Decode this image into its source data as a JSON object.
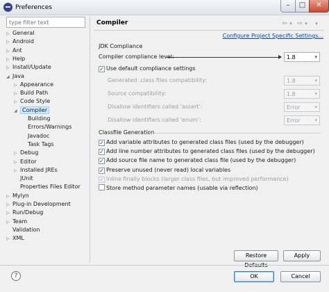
{
  "window": {
    "title": "Preferences",
    "minimize": "–",
    "maximize": "□",
    "close": "✕"
  },
  "filter": {
    "placeholder": "type filter text"
  },
  "tree": [
    {
      "label": "General",
      "expander": "▷",
      "depth": 0
    },
    {
      "label": "Android",
      "expander": "▷",
      "depth": 0
    },
    {
      "label": "Ant",
      "expander": "▷",
      "depth": 0
    },
    {
      "label": "Help",
      "expander": "▷",
      "depth": 0
    },
    {
      "label": "Install/Update",
      "expander": "▷",
      "depth": 0
    },
    {
      "label": "Java",
      "expander": "◢",
      "depth": 0
    },
    {
      "label": "Appearance",
      "expander": "▷",
      "depth": 1
    },
    {
      "label": "Build Path",
      "expander": "▷",
      "depth": 1
    },
    {
      "label": "Code Style",
      "expander": "▷",
      "depth": 1
    },
    {
      "label": "Compiler",
      "expander": "◢",
      "depth": 1,
      "selected": true
    },
    {
      "label": "Building",
      "expander": "",
      "depth": 2
    },
    {
      "label": "Errors/Warnings",
      "expander": "",
      "depth": 2
    },
    {
      "label": "Javadoc",
      "expander": "",
      "depth": 2
    },
    {
      "label": "Task Tags",
      "expander": "",
      "depth": 2
    },
    {
      "label": "Debug",
      "expander": "▷",
      "depth": 1
    },
    {
      "label": "Editor",
      "expander": "▷",
      "depth": 1
    },
    {
      "label": "Installed JREs",
      "expander": "▷",
      "depth": 1
    },
    {
      "label": "JUnit",
      "expander": "",
      "depth": 1
    },
    {
      "label": "Properties Files Editor",
      "expander": "",
      "depth": 1
    },
    {
      "label": "Mylyn",
      "expander": "▷",
      "depth": 0
    },
    {
      "label": "Plug-in Development",
      "expander": "▷",
      "depth": 0
    },
    {
      "label": "Run/Debug",
      "expander": "▷",
      "depth": 0
    },
    {
      "label": "Team",
      "expander": "▷",
      "depth": 0
    },
    {
      "label": "Validation",
      "expander": "",
      "depth": 0
    },
    {
      "label": "XML",
      "expander": "▷",
      "depth": 0
    }
  ],
  "page": {
    "title": "Compiler",
    "nav": {
      "back": "⇦",
      "back_menu": "▾",
      "forward": "⇨",
      "forward_menu": "▾",
      "view_menu": "▾"
    },
    "configure_link": "Configure Project Specific Settings...",
    "jdk_section": "JDK Compliance",
    "compliance_label": "Compiler compliance level:",
    "compliance_value": "1.8",
    "use_default": {
      "label": "Use default compliance settings",
      "checked": true
    },
    "disabled_rows": [
      {
        "label": "Generated .class files compatibility:",
        "value": "1.8"
      },
      {
        "label": "Source compatibility:",
        "value": "1.8"
      },
      {
        "label": "Disallow identifiers called 'assert':",
        "value": "Error"
      },
      {
        "label": "Disallow identifiers called 'enum':",
        "value": "Error"
      }
    ],
    "classfile_section": "Classfile Generation",
    "classfile_options": [
      {
        "label": "Add variable attributes to generated class files (used by the debugger)",
        "checked": true,
        "disabled": false
      },
      {
        "label": "Add line number attributes to generated class files (used by the debugger)",
        "checked": true,
        "disabled": false
      },
      {
        "label": "Add source file name to generated class file (used by the debugger)",
        "checked": true,
        "disabled": false
      },
      {
        "label": "Preserve unused (never read) local variables",
        "checked": true,
        "disabled": false
      },
      {
        "label": "Inline finally blocks (larger class files, but improved performance)",
        "checked": true,
        "disabled": true
      },
      {
        "label": "Store method parameter names (usable via reflection)",
        "checked": false,
        "disabled": false
      }
    ],
    "restore_defaults": "Restore Defaults",
    "apply": "Apply"
  },
  "footer": {
    "help": "?",
    "ok": "OK",
    "cancel": "Cancel"
  },
  "icons": {
    "app": "eclipse-icon",
    "check": "✓",
    "combo_caret": "▾"
  },
  "colors": {
    "link": "#0645ad",
    "selection": "#cde8ff",
    "disabled_text": "#9aa0a6"
  }
}
